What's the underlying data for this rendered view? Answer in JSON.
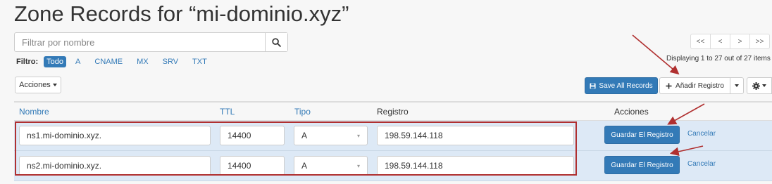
{
  "page_title": "Zone Records for “mi-dominio.xyz”",
  "search": {
    "placeholder": "Filtrar por nombre",
    "value": ""
  },
  "filter": {
    "label": "Filtro:",
    "options": [
      "Todo",
      "A",
      "CNAME",
      "MX",
      "SRV",
      "TXT"
    ],
    "active": "Todo"
  },
  "actions_dropdown_label": "Acciones",
  "pagination": {
    "buttons": [
      "<<",
      "<",
      ">",
      ">>"
    ],
    "summary": "Displaying 1 to 27 out of 27 items"
  },
  "toolbar": {
    "save_all_label": "Save All Records",
    "add_record_label": "Añadir Registro"
  },
  "table": {
    "columns": [
      "Nombre",
      "TTL",
      "Tipo",
      "Registro",
      "Acciones"
    ],
    "rows": [
      {
        "name": "ns1.mi-dominio.xyz.",
        "ttl": "14400",
        "type": "A",
        "record": "198.59.144.118",
        "save_label": "Guardar El Registro",
        "cancel_label": "Cancelar"
      },
      {
        "name": "ns2.mi-dominio.xyz.",
        "ttl": "14400",
        "type": "A",
        "record": "198.59.144.118",
        "save_label": "Guardar El Registro",
        "cancel_label": "Cancelar"
      }
    ]
  },
  "icons": {
    "search": "search-icon",
    "save": "floppy-disk-icon",
    "add": "plus-icon",
    "settings": "gear-icon"
  },
  "colors": {
    "accent": "#337ab7",
    "editing_row": "#dde9f6",
    "annotation": "#b03030"
  }
}
